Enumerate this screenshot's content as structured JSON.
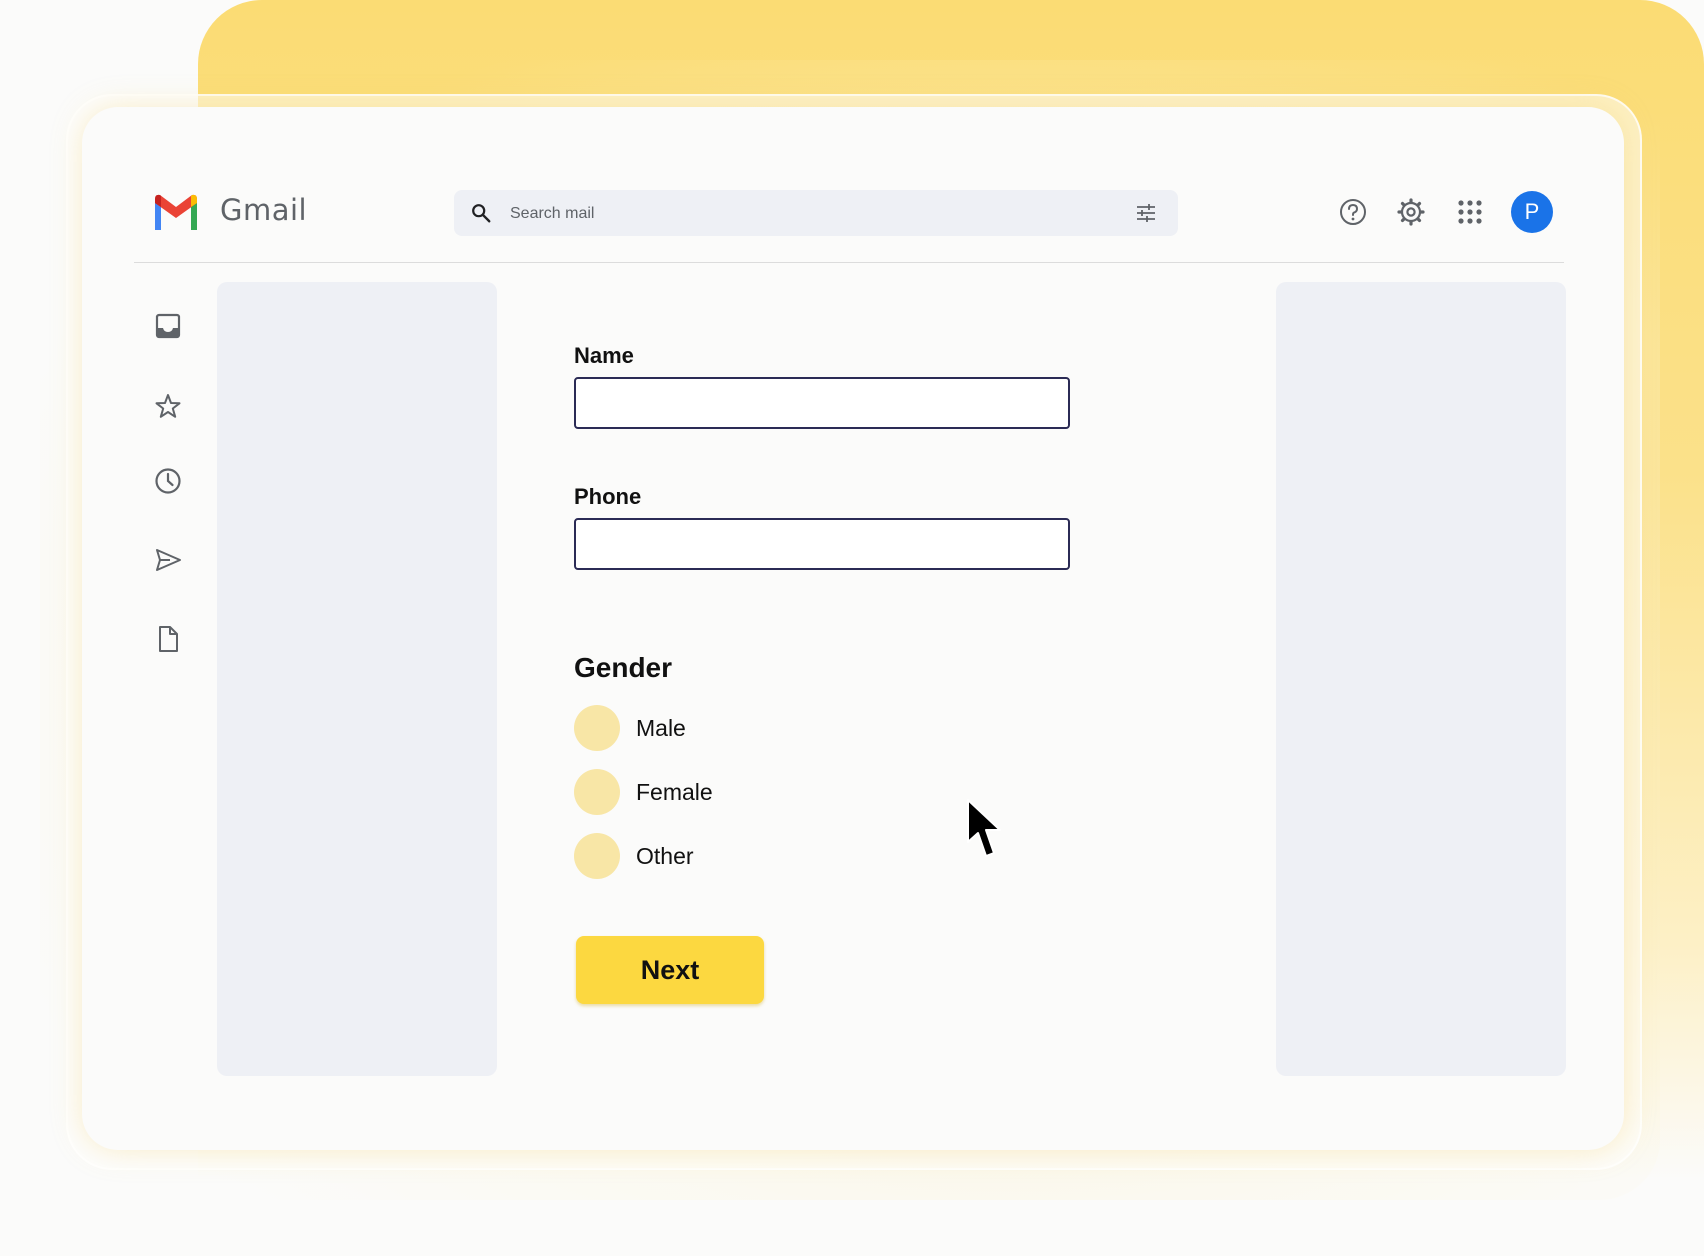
{
  "app": {
    "title": "Gmail"
  },
  "search": {
    "placeholder": "Search mail"
  },
  "header_icons": [
    "help-icon",
    "settings-icon",
    "apps-grid-icon"
  ],
  "account": {
    "avatar_letter": "P",
    "avatar_color": "#1a73e8"
  },
  "sidebar": {
    "items": [
      {
        "icon": "inbox-icon"
      },
      {
        "icon": "star-icon"
      },
      {
        "icon": "clock-icon"
      },
      {
        "icon": "send-icon"
      },
      {
        "icon": "document-icon"
      }
    ]
  },
  "form": {
    "name_label": "Name",
    "name_value": "",
    "phone_label": "Phone",
    "phone_value": "",
    "gender_title": "Gender",
    "gender_options": [
      "Male",
      "Female",
      "Other"
    ],
    "gender_selected": null,
    "next_label": "Next"
  },
  "colors": {
    "accent_yellow": "#fcd840",
    "radio_fill": "#f8e6a6",
    "field_border": "#2b2b55"
  }
}
